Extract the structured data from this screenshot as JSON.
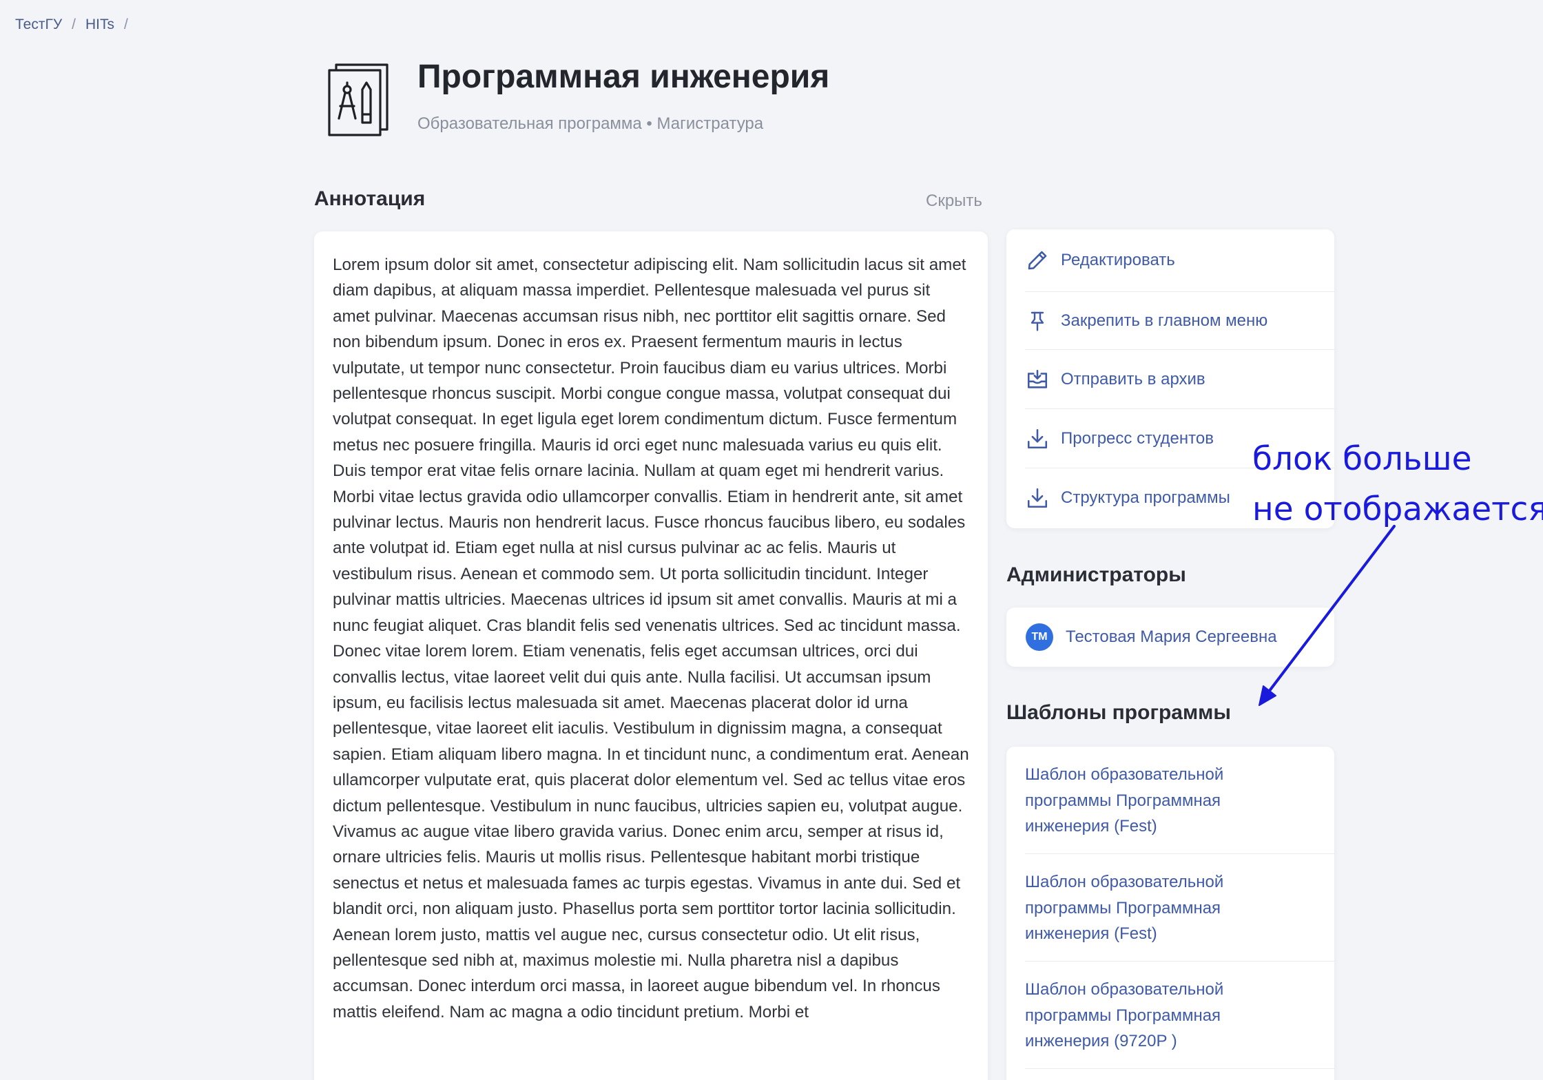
{
  "breadcrumb": {
    "items": [
      "ТестГУ",
      "HITs"
    ],
    "separator": "/"
  },
  "header": {
    "title": "Программная инженерия",
    "subtitle": "Образовательная программа • Магистратура",
    "icon": "compass-pencil-icon"
  },
  "annotation": {
    "heading": "Аннотация",
    "hide_label": "Скрыть",
    "text": "Lorem ipsum dolor sit amet, consectetur adipiscing elit. Nam sollicitudin lacus sit amet diam dapibus, at aliquam massa imperdiet. Pellentesque malesuada vel purus sit amet pulvinar. Maecenas accumsan risus nibh, nec porttitor elit sagittis ornare. Sed non bibendum ipsum. Donec in eros ex. Praesent fermentum mauris in lectus vulputate, ut tempor nunc consectetur. Proin faucibus diam eu varius ultrices. Morbi pellentesque rhoncus suscipit. Morbi congue congue massa, volutpat consequat dui volutpat consequat. In eget ligula eget lorem condimentum dictum. Fusce fermentum metus nec posuere fringilla. Mauris id orci eget nunc malesuada varius eu quis elit. Duis tempor erat vitae felis ornare lacinia. Nullam at quam eget mi hendrerit varius. Morbi vitae lectus gravida odio ullamcorper convallis. Etiam in hendrerit ante, sit amet pulvinar lectus. Mauris non hendrerit lacus. Fusce rhoncus faucibus libero, eu sodales ante volutpat id. Etiam eget nulla at nisl cursus pulvinar ac ac felis. Mauris ut vestibulum risus. Aenean et commodo sem. Ut porta sollicitudin tincidunt. Integer pulvinar mattis ultricies. Maecenas ultrices id ipsum sit amet convallis. Mauris at mi a nunc feugiat aliquet. Cras blandit felis sed venenatis ultrices. Sed ac tincidunt massa. Donec vitae lorem lorem. Etiam venenatis, felis eget accumsan ultrices, orci dui convallis lectus, vitae laoreet velit dui quis ante. Nulla facilisi. Ut accumsan ipsum ipsum, eu facilisis lectus malesuada sit amet. Maecenas placerat dolor id urna pellentesque, vitae laoreet elit iaculis. Vestibulum in dignissim magna, a consequat sapien. Etiam aliquam libero magna. In et tincidunt nunc, a condimentum erat. Aenean ullamcorper vulputate erat, quis placerat dolor elementum vel. Sed ac tellus vitae eros dictum pellentesque. Vestibulum in nunc faucibus, ultricies sapien eu, volutpat augue. Vivamus ac augue vitae libero gravida varius. Donec enim arcu, semper at risus id, ornare ultricies felis. Mauris ut mollis risus. Pellentesque habitant morbi tristique senectus et netus et malesuada fames ac turpis egestas. Vivamus in ante dui. Sed et blandit orci, non aliquam justo. Phasellus porta sem porttitor tortor lacinia sollicitudin. Aenean lorem justo, mattis vel augue nec, cursus consectetur odio. Ut elit risus, pellentesque sed nibh at, maximus molestie mi. Nulla pharetra nisl a dapibus accumsan. Donec interdum orci massa, in laoreet augue bibendum vel. In rhoncus mattis eleifend. Nam ac magna a odio tincidunt pretium. Morbi et"
  },
  "actions": [
    {
      "label": "Редактировать",
      "icon": "pencil-icon"
    },
    {
      "label": "Закрепить в главном меню",
      "icon": "pin-icon"
    },
    {
      "label": "Отправить в архив",
      "icon": "archive-icon"
    },
    {
      "label": "Прогресс студентов",
      "icon": "download-icon"
    },
    {
      "label": "Структура программы",
      "icon": "download-icon"
    }
  ],
  "administrators": {
    "heading": "Администраторы",
    "items": [
      {
        "initials": "ТМ",
        "name": "Тестовая Мария Сергеевна"
      }
    ]
  },
  "templates": {
    "heading": "Шаблоны программы",
    "items": [
      {
        "label": "Шаблон образовательной программы Программная инженерия (Fest)"
      },
      {
        "label": "Шаблон образовательной программы Программная инженерия (Fest)"
      },
      {
        "label": "Шаблон образовательной программы Программная инженерия (9720P )"
      }
    ]
  },
  "overlay_note": {
    "line1": "блок больше",
    "line2": "не отображается"
  },
  "colors": {
    "background": "#f2f4f8",
    "card": "#ffffff",
    "link": "#3e5aa8",
    "avatar": "#2f6fe0",
    "note": "#1a1adc"
  }
}
